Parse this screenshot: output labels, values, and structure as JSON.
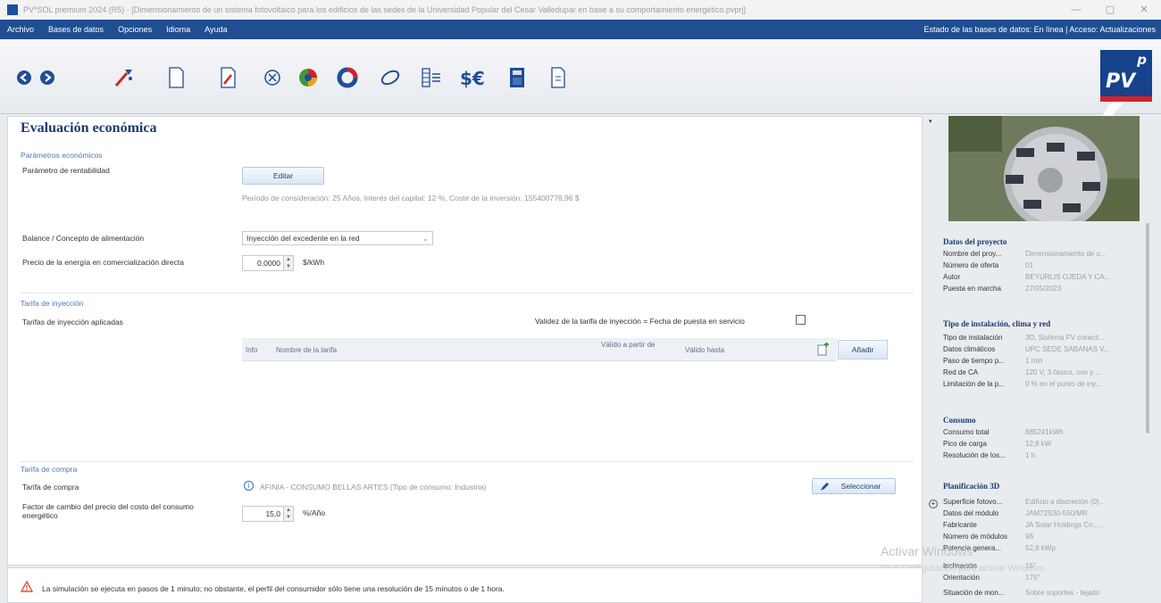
{
  "window": {
    "title": "PV*SOL premium 2024 (R5) - [Dimensionamiento de un sistema fotovoltaico para los edificios de las sedes de la Universidad Popular del Cesar Valledupar en base a su comportamiento energético.pvprj]",
    "controls": [
      "—",
      "▢",
      "✕"
    ]
  },
  "menu": {
    "items": [
      "Archivo",
      "Bases de datos",
      "Opciones",
      "Idioma",
      "Ayuda"
    ],
    "status": "Estado de las bases de datos: En línea | Acceso: Actualizaciones"
  },
  "toolbar": {
    "icons": [
      "back-icon",
      "forward-icon",
      "wizard-icon",
      "new-document-icon",
      "edit-document-icon",
      "cancel-icon",
      "pie-chart-icon",
      "donut-icon",
      "ellipse-icon",
      "table-icon",
      "currency-icon",
      "calculator-icon",
      "report-icon"
    ],
    "logo": {
      "p": "p",
      "pv": "PV"
    }
  },
  "main": {
    "heading": "Evaluación económica",
    "economic_params": {
      "section": "Parámetros económicos",
      "profitability_label": "Parámetro de rentabilidad",
      "edit_button": "Editar",
      "summary": "Período de consideración: 25 Años, Interés del capital: 12 %, Coste de la inversión: 155400776,96 $"
    },
    "balance": {
      "label": "Balance / Concepto de alimentación",
      "value": "Inyección del excedente en la red"
    },
    "energy_price": {
      "label": "Precio de la energía en comercialización directa",
      "value": "0,0000",
      "unit": "$/kWh"
    },
    "feed_in": {
      "section": "Tarifa de inyección",
      "label": "Tarifas de inyección aplicadas",
      "validity_label": "Validez de la tarifa de inyección = Fecha de puesta en servicio",
      "columns": [
        "Info",
        "Nombre de la tarifa",
        "Válido a partir de",
        "Válido hasta"
      ],
      "add_button": "Añadir"
    },
    "purchase": {
      "section": "Tarifa de compra",
      "tariff_label": "Tarifa de compra",
      "tariff_value": "AFINIA - CONSUMO BELLAS ARTES (Tipo de consumo: Industria)",
      "select_button": "Seleccionar",
      "factor_label": "Factor de cambio del precio del costo del consumo energético",
      "factor_value": "15,0",
      "factor_unit": "%/Año"
    }
  },
  "sidebar": {
    "project": {
      "title": "Datos del proyecto",
      "rows": [
        {
          "k": "Nombre del proy...",
          "v": "Dimensionamiento de u..."
        },
        {
          "k": "Número de oferta",
          "v": "01"
        },
        {
          "k": "Autor",
          "v": "BEYURLIS OJEDA Y CA..."
        },
        {
          "k": "Puesta en marcha",
          "v": "27/05/2023"
        }
      ]
    },
    "installation": {
      "title": "Tipo de instalación, clima y red",
      "rows": [
        {
          "k": "Tipo de instalación",
          "v": "3D, Sistema FV conect..."
        },
        {
          "k": "Datos climáticos",
          "v": "UPC SEDE SABANAS V..."
        },
        {
          "k": "Paso de tiempo p...",
          "v": "1 min"
        },
        {
          "k": "Red de CA",
          "v": "120 V, 3-fásico, con y ..."
        },
        {
          "k": "Limitación de la p...",
          "v": "0 % en el punto de iny..."
        }
      ]
    },
    "consumption": {
      "title": "Consumo",
      "rows": [
        {
          "k": "Consumo total",
          "v": "885241kWh"
        },
        {
          "k": "Pico de carga",
          "v": "12,8 kW"
        },
        {
          "k": "Resolución de los...",
          "v": "1 h"
        }
      ]
    },
    "planning": {
      "title": "Planificación 3D",
      "rows": [
        {
          "k": "Superficie fotovo...",
          "v": "Edificio a discreción (0)..."
        },
        {
          "k": "Datos del módulo",
          "v": "JAM72S30-550/MR"
        },
        {
          "k": "Fabricante",
          "v": "JA Solar Holdings Co., ..."
        },
        {
          "k": "Número de módulos",
          "v": "96"
        },
        {
          "k": "Potencia genera...",
          "v": "52,8 kWp"
        },
        {
          "k": "Inclinación",
          "v": "15°"
        },
        {
          "k": "Orientación",
          "v": "175°"
        },
        {
          "k": "Situación de mon...",
          "v": "Sobre soportes - tejado"
        }
      ]
    }
  },
  "watermark": {
    "line1": "Activar Windows",
    "line2": "Ve a Configuración para activar Windows."
  },
  "statusbar": {
    "message": "La simulación se ejecuta en pasos de 1 minuto; no obstante, el perfil del consumidor sólo tiene una resolución de 15 minutos o de 1 hora."
  }
}
